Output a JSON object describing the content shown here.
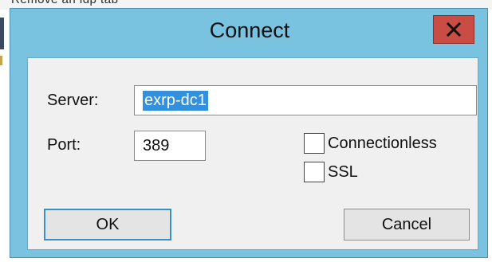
{
  "background": {
    "partial_text": "Remove an ldp tab"
  },
  "dialog": {
    "title": "Connect",
    "close_glyph": "x",
    "server_label": "Server:",
    "server_value": "exrp-dc1",
    "port_label": "Port:",
    "port_value": "389",
    "checkbox_connectionless": {
      "label": "Connectionless",
      "checked": false
    },
    "checkbox_ssl": {
      "label": "SSL",
      "checked": false
    },
    "ok_label": "OK",
    "cancel_label": "Cancel"
  },
  "colors": {
    "title_bar": "#79c3e1",
    "close_button": "#c94d45",
    "selection": "#3390dc",
    "client_area": "#f0f0f0"
  },
  "icons": {
    "close": "close-icon"
  }
}
